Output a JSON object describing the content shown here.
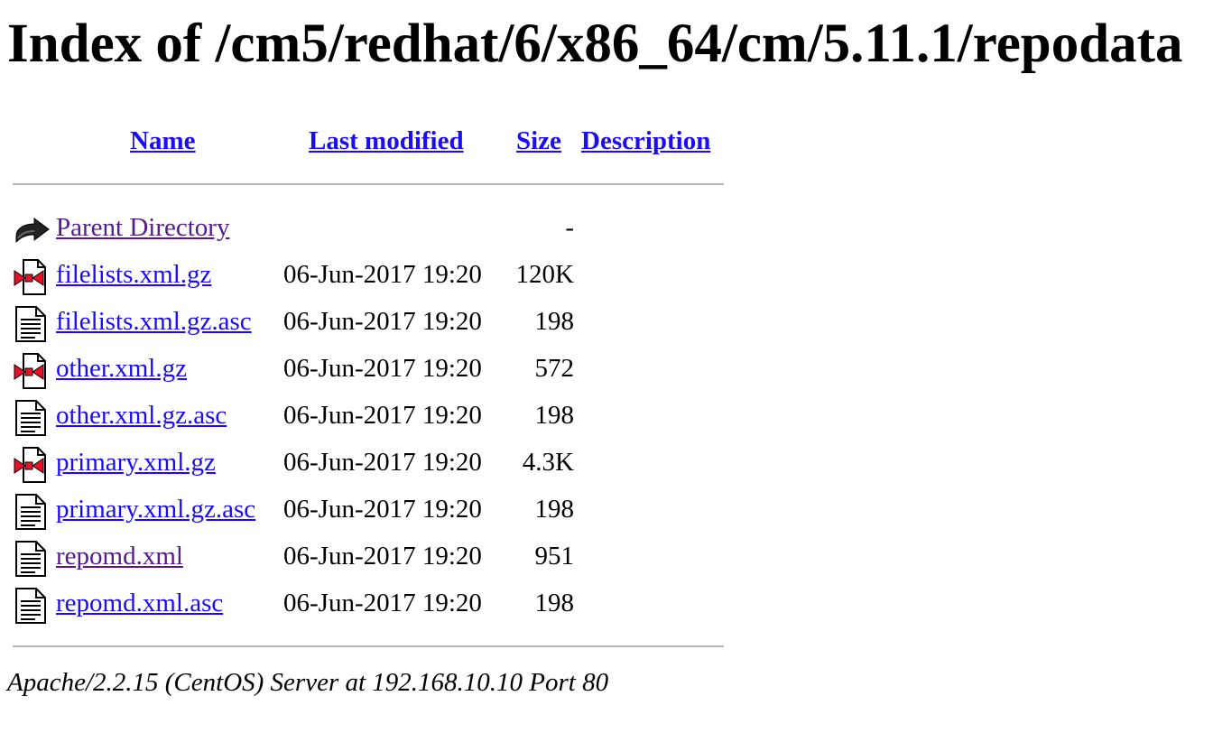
{
  "page_title": "Index of /cm5/redhat/6/x86_64/cm/5.11.1/repodata",
  "columns": {
    "name": "Name",
    "last_modified": "Last modified",
    "size": "Size",
    "description": "Description"
  },
  "entries": [
    {
      "icon": "back-icon",
      "name": "Parent Directory",
      "modified": "",
      "size": "-",
      "visited": true
    },
    {
      "icon": "compressed-file-icon",
      "name": "filelists.xml.gz",
      "modified": "06-Jun-2017 19:20",
      "size": "120K",
      "visited": false
    },
    {
      "icon": "text-file-icon",
      "name": "filelists.xml.gz.asc",
      "modified": "06-Jun-2017 19:20",
      "size": "198",
      "visited": false
    },
    {
      "icon": "compressed-file-icon",
      "name": "other.xml.gz",
      "modified": "06-Jun-2017 19:20",
      "size": "572",
      "visited": false
    },
    {
      "icon": "text-file-icon",
      "name": "other.xml.gz.asc",
      "modified": "06-Jun-2017 19:20",
      "size": "198",
      "visited": false
    },
    {
      "icon": "compressed-file-icon",
      "name": "primary.xml.gz",
      "modified": "06-Jun-2017 19:20",
      "size": "4.3K",
      "visited": false
    },
    {
      "icon": "text-file-icon",
      "name": "primary.xml.gz.asc",
      "modified": "06-Jun-2017 19:20",
      "size": "198",
      "visited": false
    },
    {
      "icon": "text-file-icon",
      "name": "repomd.xml",
      "modified": "06-Jun-2017 19:20",
      "size": "951",
      "visited": true
    },
    {
      "icon": "text-file-icon",
      "name": "repomd.xml.asc",
      "modified": "06-Jun-2017 19:20",
      "size": "198",
      "visited": false
    }
  ],
  "footer": "Apache/2.2.15 (CentOS) Server at 192.168.10.10 Port 80",
  "colors": {
    "link": "#1a0dee",
    "visited_link": "#551a8b",
    "rule": "#b5b5b5"
  }
}
